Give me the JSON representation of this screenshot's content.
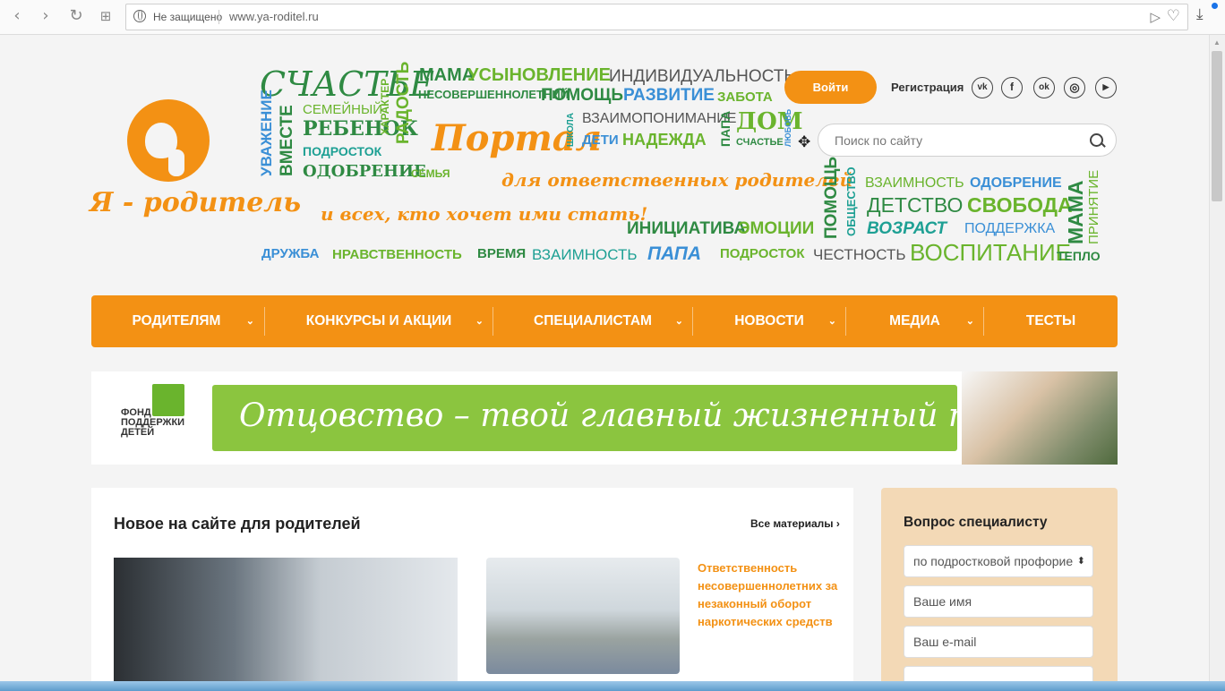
{
  "browser": {
    "back_icon": "‹",
    "forward_icon": "›",
    "reload_icon": "↻",
    "tabs_icon": "⊞",
    "security_label": "Не защищено",
    "url": "www.ya-roditel.ru",
    "send_icon": "▷",
    "heart_icon": "♡",
    "download_icon": "⤓"
  },
  "logo": {
    "name": "Я - родитель"
  },
  "wordcloud": {
    "schastye": "СЧАСТЬЕ",
    "mama": "МАМА",
    "usynovlenie": "УСЫНОВЛЕНИЕ",
    "individ": "ИНДИВИДУАЛЬНОСТЬ",
    "nesover": "НЕСОВЕРШЕННОЛЕТНИЙ",
    "pomosh": "ПОМОЩЬ",
    "razvitie": "РАЗВИТИЕ",
    "zabota": "ЗАБОТА",
    "uvazhenie": "УВАЖЕНИЕ",
    "vmeste": "ВМЕСТЕ",
    "semeyny": "СЕМЕЙНЫЙ",
    "rebenok": "РЕБЕНОК",
    "podrostok1": "ПОДРОСТОК",
    "harakter": "ХАРАКТЕР",
    "radost": "РАДОСТЬ",
    "portal": "Портал",
    "shkola": "ШКОЛА",
    "vzaimoponimanie": "ВЗАИМОПОНИМАНИЕ",
    "deti": "ДЕТИ",
    "nadezhda": "НАДЕЖДА",
    "papa_v": "ПАПА",
    "dom": "ДОМ",
    "schastye2": "СЧАСТЬЕ",
    "lyubov": "ЛЮБОВЬ",
    "odobrenie1": "ОДОБРЕНИЕ",
    "semya": "СЕМЬЯ",
    "otvetstv": "для ответственных родителей",
    "vseh": "и всех, кто хочет ими стать!",
    "pomosh_v": "ПОМОЩЬ",
    "obshestvo": "ОБЩЕСТВО",
    "vzaimnost1": "ВЗАИМНОСТЬ",
    "odobrenie2": "ОДОБРЕНИЕ",
    "detstvo": "ДЕТСТВО",
    "svoboda": "СВОБОДА",
    "vozrast": "ВОЗРАСТ",
    "podderzhka": "ПОДДЕРЖКА",
    "mama_v": "МАМА",
    "prinyatie": "ПРИНЯТИЕ",
    "iniciativa": "ИНИЦИАТИВА",
    "emocii": "ЭМОЦИИ",
    "druzhba": "ДРУЖБА",
    "nravstv": "НРАВСТВЕННОСТЬ",
    "vremya": "ВРЕМЯ",
    "vzaimnost2": "ВЗАИМНОСТЬ",
    "papa": "ПАПА",
    "podrostok2": "ПОДРОСТОК",
    "chestnost": "ЧЕСТНОСТЬ",
    "vospitanie": "ВОСПИТАНИЕ",
    "teplo": "ТЕПЛО"
  },
  "header": {
    "login_label": "Войти",
    "register_label": "Регистрация",
    "social": [
      "vk",
      "f",
      "ok",
      "◎",
      "▶"
    ],
    "search_placeholder": "Поиск по сайту"
  },
  "menu": {
    "items": [
      "РОДИТЕЛЯМ",
      "КОНКУРСЫ И АКЦИИ",
      "СПЕЦИАЛИСТАМ",
      "НОВОСТИ",
      "МЕДИА",
      "ТЕСТЫ"
    ],
    "chevron": "⌄"
  },
  "banner": {
    "fond_text": "ФОНД\nПОДДЕРЖКИ\nДЕТЕЙ",
    "slogan": "Отцовство – твой главный жизненный проект!"
  },
  "news": {
    "title": "Новое на сайте для родителей",
    "all_link": "Все материалы ›",
    "article_title": "Ответственность несовершеннолетних за незаконный оборот наркотических средств"
  },
  "ask": {
    "title": "Вопрос специалисту",
    "topic_select": "по подростковой профорие",
    "name_placeholder": "Ваше имя",
    "email_placeholder": "Ваш e-mail"
  },
  "colors": {
    "accent": "#f39114",
    "green": "#6ab42d",
    "banner_green": "#8bc53f",
    "ask_bg": "#f3d9b6"
  }
}
